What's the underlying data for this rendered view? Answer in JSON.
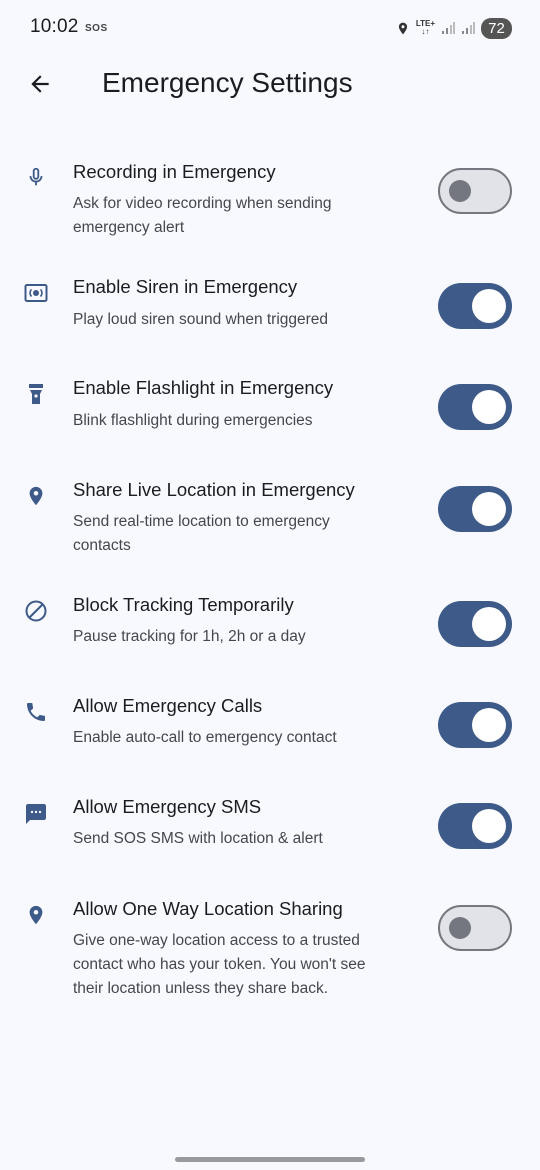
{
  "status_bar": {
    "time": "10:02",
    "sos": "SOS",
    "network": "LTE+",
    "battery": "72"
  },
  "app_bar": {
    "title": "Emergency Settings"
  },
  "colors": {
    "switch_on": "#3d5a88",
    "icon": "#3d5a88",
    "switch_off_track": "#e2e2e9",
    "switch_off_outline": "#74777f"
  },
  "settings": [
    {
      "icon": "microphone-icon",
      "title": "Recording in Emergency",
      "subtitle_lines": [
        "Ask for video recording when sending",
        "emergency alert"
      ],
      "enabled": false
    },
    {
      "icon": "siren-icon",
      "title": "Enable Siren in Emergency",
      "subtitle_lines": [
        "Play loud siren sound when triggered"
      ],
      "enabled": true
    },
    {
      "icon": "flashlight-icon",
      "title": "Enable Flashlight in Emergency",
      "subtitle_lines": [
        "Blink flashlight during emergencies"
      ],
      "enabled": true
    },
    {
      "icon": "location-pin-icon",
      "title": "Share Live Location in Emergency",
      "subtitle_lines": [
        "Send real-time location to emergency",
        "contacts"
      ],
      "enabled": true
    },
    {
      "icon": "block-icon",
      "title": "Block Tracking Temporarily",
      "subtitle_lines": [
        "Pause tracking for 1h, 2h or a day"
      ],
      "enabled": true
    },
    {
      "icon": "phone-icon",
      "title": "Allow Emergency Calls",
      "subtitle_lines": [
        "Enable auto-call to emergency contact"
      ],
      "enabled": true
    },
    {
      "icon": "sms-icon",
      "title": "Allow Emergency SMS",
      "subtitle_lines": [
        "Send SOS SMS with location & alert"
      ],
      "enabled": true
    },
    {
      "icon": "location-pin-icon",
      "title": "Allow One Way Location Sharing",
      "subtitle_lines": [
        "Give one-way location access to a trusted",
        "contact who has your token. You won't see",
        "their location unless they share back."
      ],
      "enabled": false
    }
  ]
}
